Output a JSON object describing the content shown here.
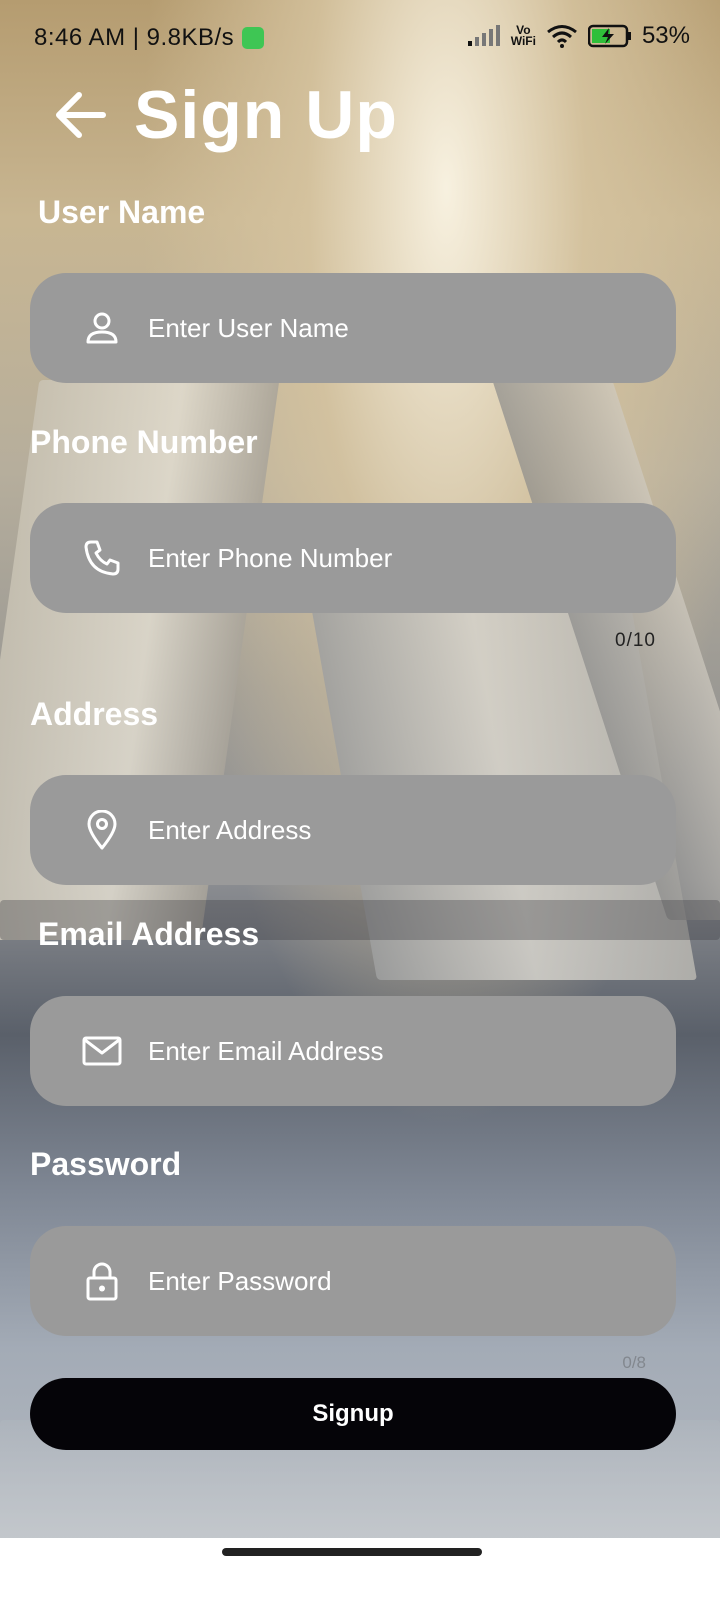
{
  "status_bar": {
    "time_speed": "8:46 AM | 9.8KB/s",
    "vowifi_top": "Vo",
    "vowifi_bottom": "WiFi",
    "battery": "53%"
  },
  "header": {
    "title": "Sign Up",
    "back_icon": "arrow-left-icon"
  },
  "form": {
    "user_name": {
      "label": "User Name",
      "placeholder": "Enter User Name",
      "icon": "person-icon"
    },
    "phone": {
      "label": "Phone Number",
      "placeholder": "Enter Phone Number",
      "icon": "phone-icon",
      "counter": "0/10"
    },
    "address": {
      "label": "Address",
      "placeholder": "Enter Address",
      "icon": "location-pin-icon"
    },
    "email": {
      "label": "Email Address",
      "placeholder": "Enter Email Address",
      "icon": "envelope-icon"
    },
    "password": {
      "label": "Password",
      "placeholder": "Enter Password",
      "icon": "lock-icon",
      "counter": "0/8"
    },
    "submit_label": "Signup"
  },
  "colors": {
    "field_bg": "#9a9a9a",
    "button_bg": "#050408",
    "text": "#ffffff"
  }
}
